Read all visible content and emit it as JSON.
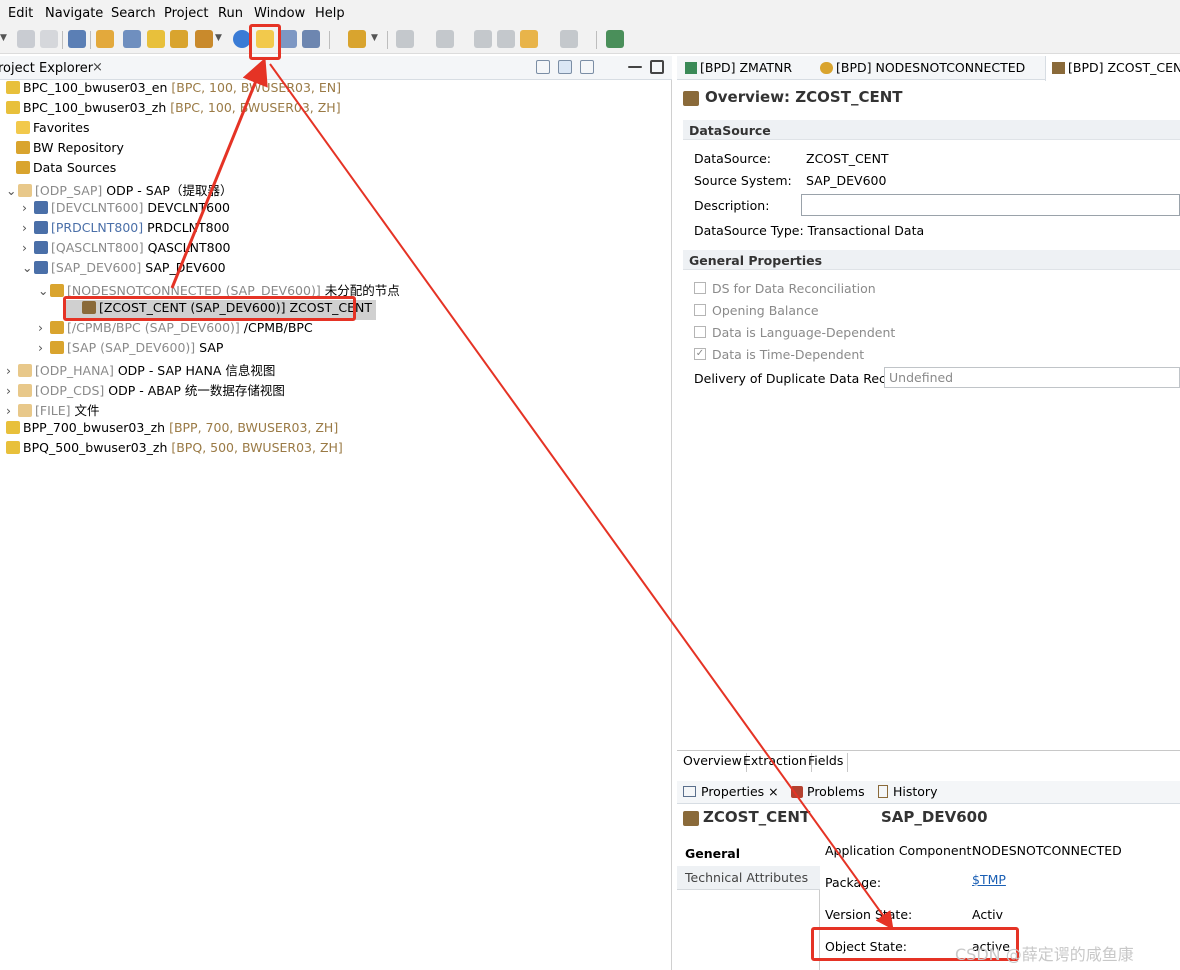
{
  "menu": [
    "Edit",
    "Navigate",
    "Search",
    "Project",
    "Run",
    "Window",
    "Help"
  ],
  "project_explorer": {
    "tab_label": "roject Explorer",
    "close": "×",
    "tree": [
      {
        "chev": "",
        "decoration": "",
        "label": "BPC_100_bwuser03_en",
        "suffix": "[BPC, 100, BWUSER03, EN]"
      },
      {
        "chev": "",
        "decoration": "",
        "label": "BPC_100_bwuser03_zh",
        "suffix": "[BPC, 100, BWUSER03, ZH]"
      },
      {
        "chev": "",
        "decoration": "",
        "label": "Favorites",
        "suffix": ""
      },
      {
        "chev": "",
        "decoration": "",
        "label": "BW Repository",
        "suffix": ""
      },
      {
        "chev": "",
        "decoration": "",
        "label": "Data Sources",
        "suffix": ""
      },
      {
        "chev": "v",
        "decoration": "[ODP_SAP]",
        "label": "ODP - SAP（提取器）",
        "suffix": ""
      },
      {
        "chev": ">",
        "decoration": "[DEVCLNT600]",
        "label": "DEVCLNT600",
        "suffix": ""
      },
      {
        "chev": ">",
        "decoration": "[PRDCLNT800]",
        "label": "PRDCLNT800",
        "suffix": ""
      },
      {
        "chev": ">",
        "decoration": "[QASCLNT800]",
        "label": "QASCLNT800",
        "suffix": ""
      },
      {
        "chev": "v",
        "decoration": "[SAP_DEV600]",
        "label": "SAP_DEV600",
        "suffix": ""
      },
      {
        "chev": "v",
        "decoration": "[NODESNOTCONNECTED (SAP_DEV600)]",
        "label": "未分配的节点",
        "suffix": ""
      },
      {
        "chev": "",
        "decoration": "",
        "label": "[ZCOST_CENT (SAP_DEV600)] ZCOST_CENT",
        "suffix": ""
      },
      {
        "chev": ">",
        "decoration": "[/CPMB/BPC (SAP_DEV600)]",
        "label": "/CPMB/BPC",
        "suffix": ""
      },
      {
        "chev": ">",
        "decoration": "[SAP (SAP_DEV600)]",
        "label": "SAP",
        "suffix": ""
      },
      {
        "chev": ">",
        "decoration": "[ODP_HANA]",
        "label": "ODP - SAP HANA 信息视图",
        "suffix": ""
      },
      {
        "chev": ">",
        "decoration": "[ODP_CDS]",
        "label": "ODP - ABAP 统一数据存储视图",
        "suffix": ""
      },
      {
        "chev": ">",
        "decoration": "[FILE]",
        "label": "文件",
        "suffix": ""
      },
      {
        "chev": "",
        "decoration": "",
        "label": "BPP_700_bwuser03_zh",
        "suffix": "[BPP, 700, BWUSER03, ZH]"
      },
      {
        "chev": "",
        "decoration": "",
        "label": "BPQ_500_bwuser03_zh",
        "suffix": "[BPQ, 500, BWUSER03, ZH]"
      }
    ]
  },
  "editor_tabs": [
    "[BPD] ZMATNR",
    "[BPD] NODESNOTCONNECTED",
    "[BPD] ZCOST_CENT"
  ],
  "overview": {
    "title": "Overview: ZCOST_CENT",
    "datasource_header": "DataSource",
    "datasource_label": "DataSource:",
    "datasource_value": "ZCOST_CENT",
    "source_system_label": "Source System:",
    "source_system_value": "SAP_DEV600",
    "description_label": "Description:",
    "description_value": "",
    "ds_type_label": "DataSource Type:",
    "ds_type_value": "Transactional Data",
    "general_header": "General Properties",
    "checkboxes": [
      {
        "label": "DS for Data Reconciliation",
        "checked": false
      },
      {
        "label": "Opening Balance",
        "checked": false
      },
      {
        "label": "Data is Language-Dependent",
        "checked": false
      },
      {
        "label": "Data is Time-Dependent",
        "checked": true
      }
    ],
    "delivery_label": "Delivery of Duplicate Data Recs.",
    "delivery_value": "Undefined"
  },
  "bottom_tabs": [
    "Overview",
    "Extraction",
    "Fields"
  ],
  "properties": {
    "tabs": [
      "Properties",
      "Problems",
      "History"
    ],
    "close": "×",
    "title": "ZCOST_CENT",
    "system": "SAP_DEV600",
    "side_tabs": [
      "General",
      "Technical Attributes"
    ],
    "rows": [
      {
        "label": "Application Component:",
        "value": "NODESNOTCONNECTED",
        "link": false
      },
      {
        "label": "Package:",
        "value": "$TMP",
        "link": true
      },
      {
        "label": "Version State:",
        "value": "Activ",
        "link": false
      },
      {
        "label": "Object State:",
        "value": "active",
        "link": false
      }
    ]
  },
  "watermark": "CSDN @薛定谔的咸鱼康",
  "colors": {
    "annotation_red": "#e53325",
    "link_blue": "#1a5fb4",
    "decoration_brown": "#9a7a45"
  }
}
